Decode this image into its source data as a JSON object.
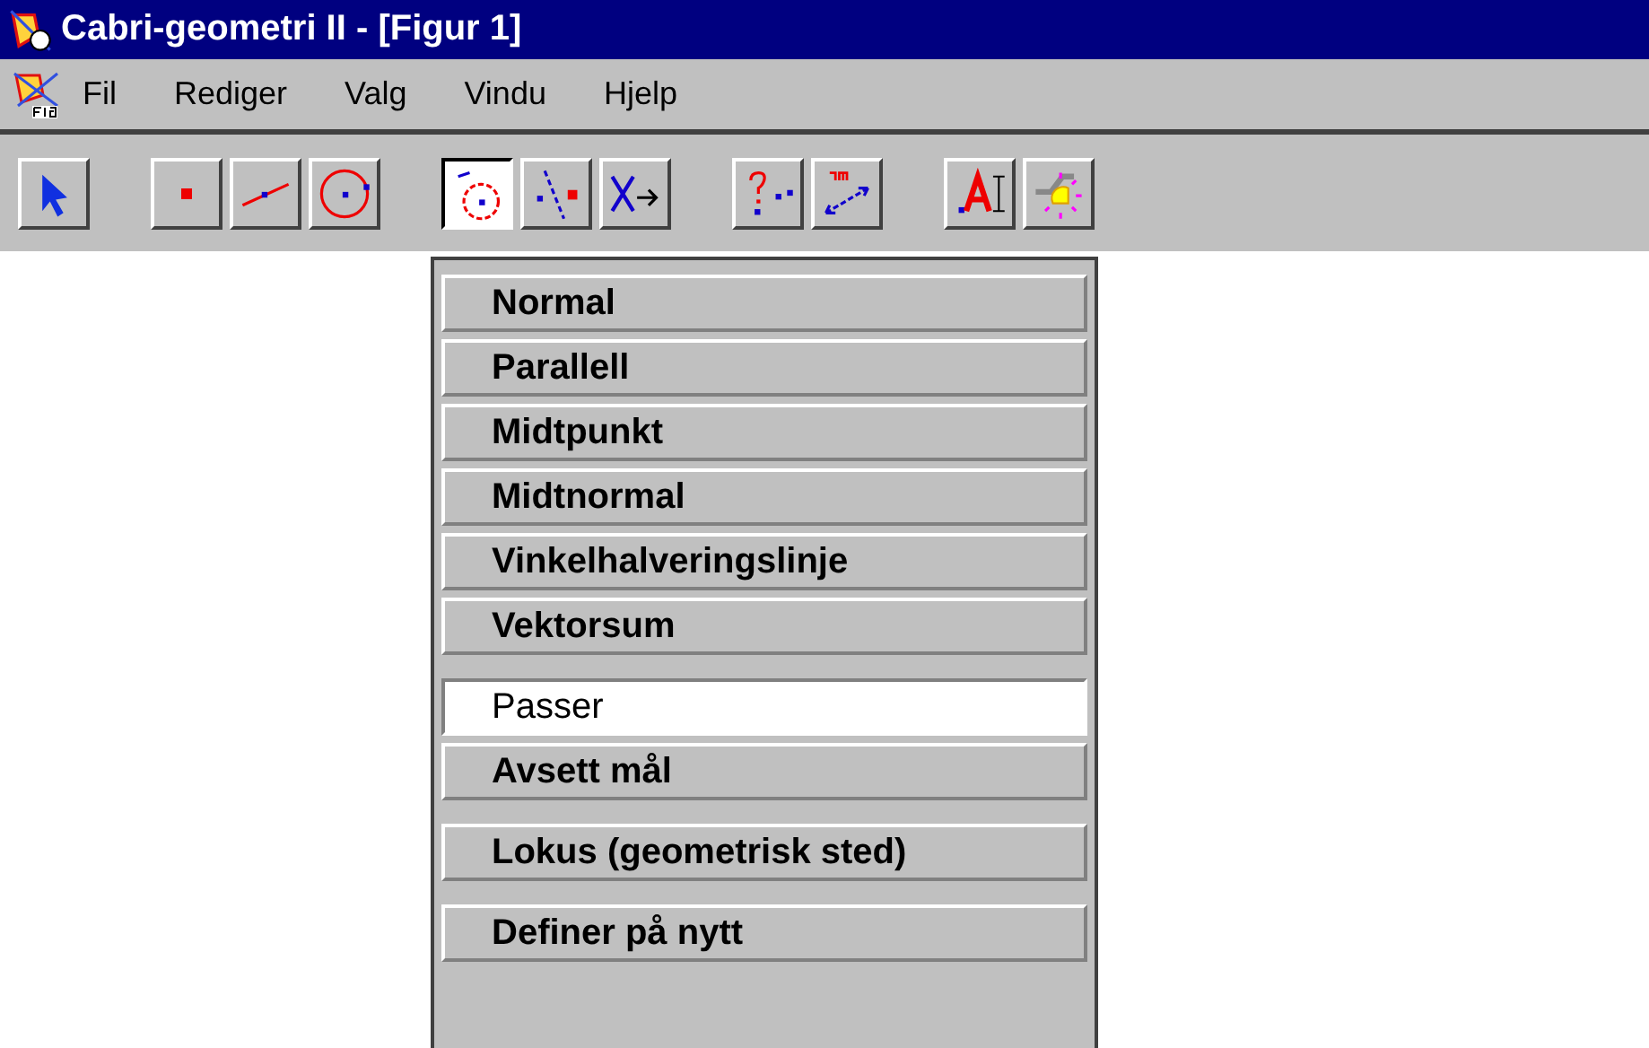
{
  "window": {
    "title": "Cabri-geometri II - [Figur 1]"
  },
  "menu_bar": [
    {
      "label": "Fil"
    },
    {
      "label": "Rediger"
    },
    {
      "label": "Valg"
    },
    {
      "label": "Vindu"
    },
    {
      "label": "Hjelp"
    }
  ],
  "toolbar": [
    [
      {
        "kind": "pointer",
        "pressed": false
      }
    ],
    [
      {
        "kind": "point",
        "pressed": false
      },
      {
        "kind": "line",
        "pressed": false
      },
      {
        "kind": "circle",
        "pressed": false
      }
    ],
    [
      {
        "kind": "compass",
        "pressed": true
      },
      {
        "kind": "perpendicular",
        "pressed": false
      },
      {
        "kind": "transform",
        "pressed": false
      }
    ],
    [
      {
        "kind": "query",
        "pressed": false
      },
      {
        "kind": "measure",
        "pressed": false
      }
    ],
    [
      {
        "kind": "text",
        "pressed": false
      },
      {
        "kind": "display",
        "pressed": false
      }
    ]
  ],
  "dropdown": [
    [
      {
        "label": "Normal",
        "selected": false
      },
      {
        "label": "Parallell",
        "selected": false
      },
      {
        "label": "Midtpunkt",
        "selected": false
      },
      {
        "label": "Midtnormal",
        "selected": false
      },
      {
        "label": "Vinkelhalveringslinje",
        "selected": false
      },
      {
        "label": "Vektorsum",
        "selected": false
      }
    ],
    [
      {
        "label": "Passer",
        "selected": true
      },
      {
        "label": "Avsett mål",
        "selected": false
      }
    ],
    [
      {
        "label": "Lokus (geometrisk sted)",
        "selected": false
      }
    ],
    [
      {
        "label": "Definer på nytt",
        "selected": false
      }
    ]
  ]
}
